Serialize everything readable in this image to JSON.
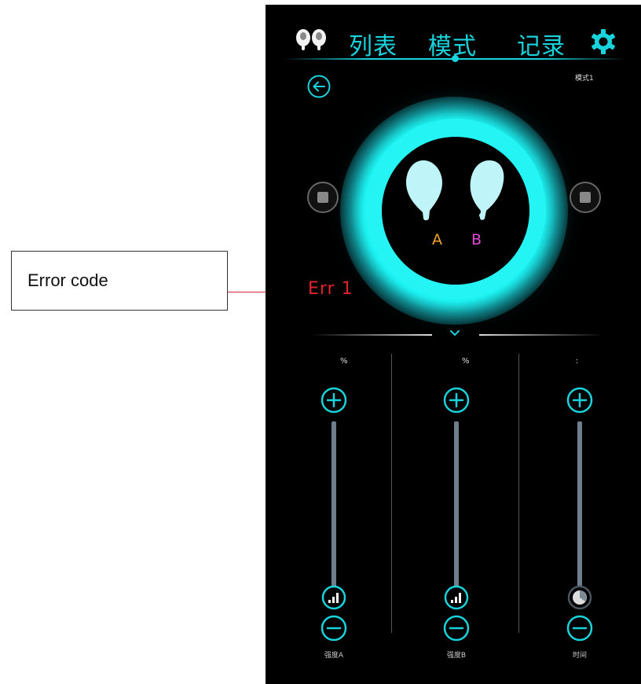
{
  "annotation": {
    "callout_text": "Error code"
  },
  "nav": {
    "items": [
      {
        "label": "列表"
      },
      {
        "label": "模式"
      },
      {
        "label": "记录"
      }
    ],
    "active_index": 1,
    "earbuds_icon": "earbuds-icon",
    "settings_icon": "gear-icon"
  },
  "mode_label": "模式1",
  "device": {
    "channel_a": "A",
    "channel_b": "B"
  },
  "error": {
    "text": "Err 1"
  },
  "controls": [
    {
      "value_unit": "%",
      "label": "强度A",
      "thumb_icon": "signal-bars-icon"
    },
    {
      "value_unit": "%",
      "label": "强度B",
      "thumb_icon": "signal-bars-icon"
    },
    {
      "value_unit": ":",
      "label": "时间",
      "thumb_icon": "clock-icon"
    }
  ],
  "colors": {
    "accent": "#19d3dc",
    "glow": "#24f4f4",
    "error": "#e0232c",
    "channel_a": "#f0a42a",
    "channel_b": "#e24ad8",
    "background": "#000000"
  }
}
